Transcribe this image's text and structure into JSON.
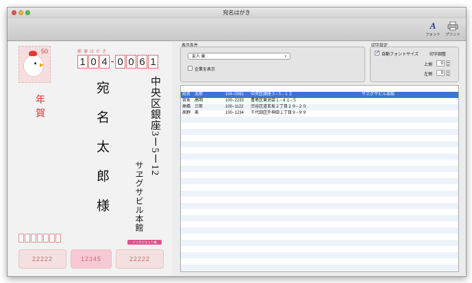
{
  "window": {
    "title": "宛名はがき"
  },
  "toolbar": {
    "font_label": "フォント",
    "print_label": "プリント",
    "font_glyph": "A"
  },
  "postcard": {
    "heading": "郵便はがき",
    "stamp_value": "50",
    "postal_code": [
      "1",
      "0",
      "4",
      "0",
      "0",
      "6",
      "1"
    ],
    "nenga": [
      "年",
      "賀"
    ],
    "recipient": "宛名太郎様",
    "address": "中央区銀座3ー5ー12",
    "company": "サヱグサビル本館",
    "badge": "インクジェット紙",
    "lottery": [
      "22222",
      "12345",
      "22222"
    ]
  },
  "display_conditions": {
    "label": "表示条件",
    "select_value": "友人 東",
    "show_company_label": "企業を表示",
    "show_company_checked": false
  },
  "print_settings": {
    "label": "印字設定",
    "auto_font_label": "自動フォントサイズ",
    "auto_font_checked": true,
    "adjust_label": "印字調整",
    "top_label": "上側",
    "top_value": "0",
    "left_label": "左側",
    "left_value": "0"
  },
  "address_list": {
    "rows": [
      {
        "name": "宛名　太郎",
        "zip": "104−0061",
        "address": "中央区銀座３−５−１２",
        "company": "サヱグサビル本館",
        "selected": true
      },
      {
        "name": "宮本　高明",
        "zip": "100−2233",
        "address": "豊島区東池袋１−４１−５",
        "company": "",
        "selected": false
      },
      {
        "name": "高橋　三郎",
        "zip": "100−1122",
        "address": "渋谷区道玄坂２丁目２９−２０",
        "company": "",
        "selected": false
      },
      {
        "name": "高野　楽",
        "zip": "100−1234",
        "address": "千代田区外神田１丁目９−９９",
        "company": "",
        "selected": false
      }
    ]
  },
  "colors": {
    "selection": "#3b75d6",
    "stamp_red": "#de6b6b",
    "accent_red": "#e03434"
  }
}
